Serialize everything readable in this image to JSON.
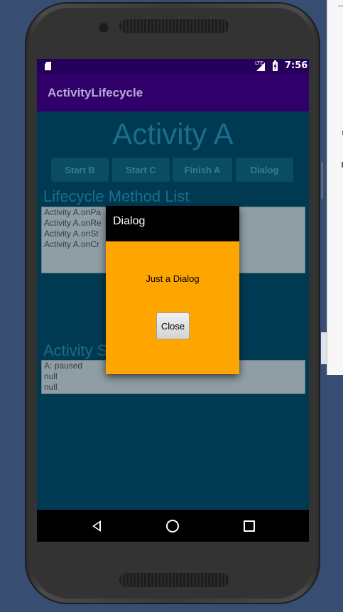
{
  "status_bar": {
    "time": "7:56",
    "network": "LTE"
  },
  "app_bar": {
    "title": "ActivityLifecycle"
  },
  "main": {
    "heading": "Activity A",
    "buttons": [
      "Start B",
      "Start C",
      "Finish A",
      "Dialog"
    ],
    "lifecycle_title": "Lifecycle Method List",
    "lifecycle_items": [
      "Activity A.onPa",
      "Activity A.onRe",
      "Activity A.onSt",
      "Activity A.onCr"
    ],
    "status_title": "Activity S",
    "status_items": [
      "A: paused",
      "null",
      "null"
    ]
  },
  "dialog": {
    "title": "Dialog",
    "message": "Just a Dialog",
    "close_label": "Close"
  },
  "icons": {
    "nav_back": "back-triangle-icon",
    "nav_home": "home-circle-icon",
    "nav_recent": "recent-square-icon"
  },
  "colors": {
    "status_bar": "#25005a",
    "app_bar": "#2f006a",
    "background": "#003a52",
    "dialog_body": "#ffa500"
  }
}
